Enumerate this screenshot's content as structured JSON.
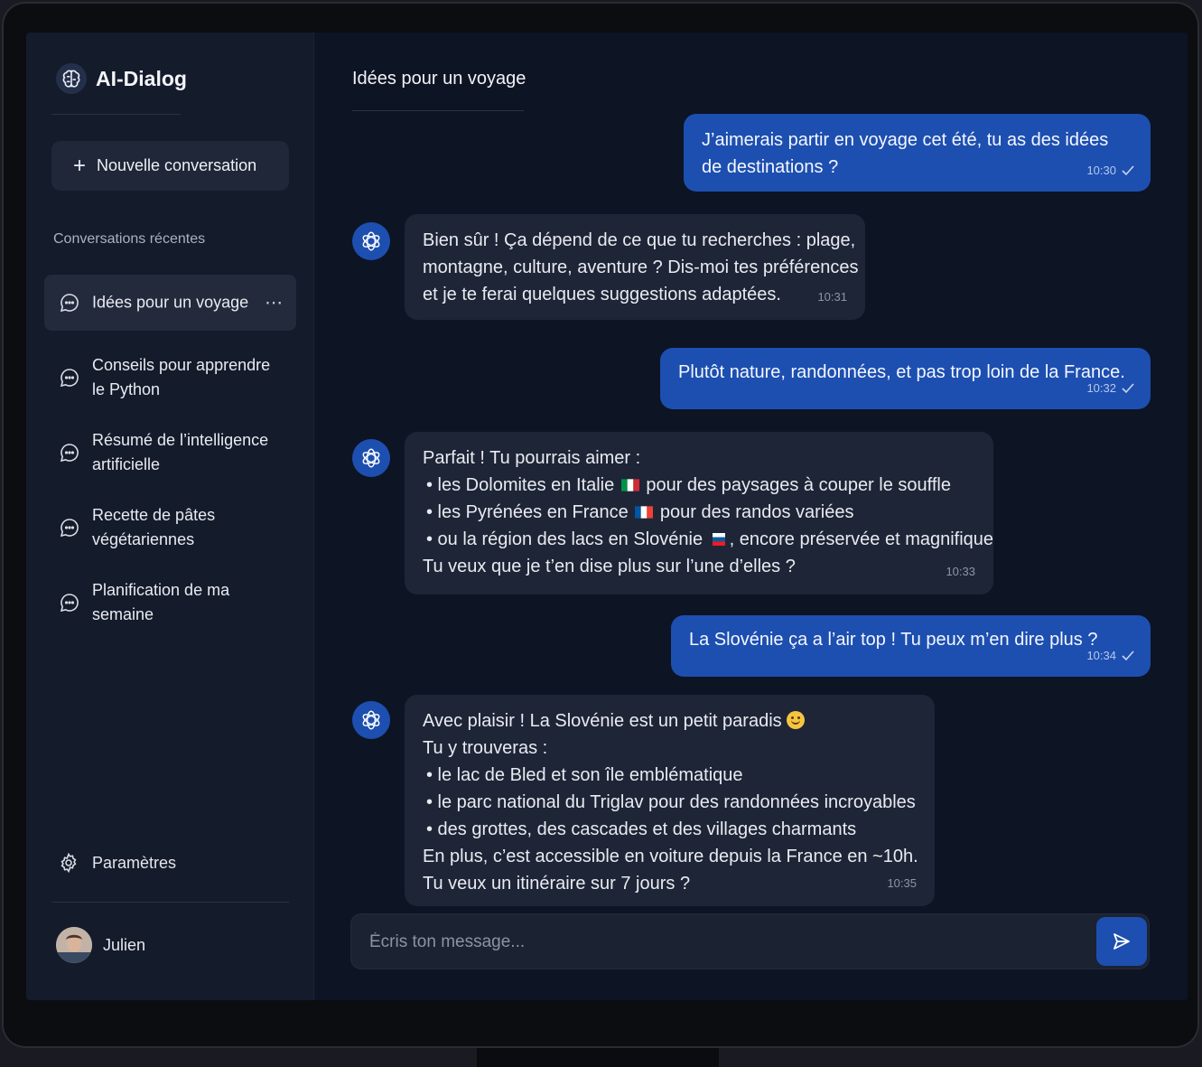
{
  "app": {
    "name": "AI-Dialog"
  },
  "sidebar": {
    "new_chat_label": "Nouvelle conversation",
    "recent_title": "Conversations récentes",
    "conversations": [
      {
        "label": "Idées pour un voyage",
        "active": true
      },
      {
        "label": "Conseils pour apprendre le Python"
      },
      {
        "label": "Résumé de l’intelligence artificielle"
      },
      {
        "label": "Recette de pâtes végétariennes"
      },
      {
        "label": "Planification de ma semaine"
      }
    ],
    "more_icon": "⋯",
    "settings_label": "Paramètres",
    "user_name": "Julien"
  },
  "chat": {
    "title": "Idées pour un voyage",
    "messages": [
      {
        "role": "user",
        "lines": [
          "J’aimerais partir en voyage cet été, tu as des idées",
          "de destinations ?"
        ],
        "time": "10:30"
      },
      {
        "role": "assistant",
        "lines": [
          "Bien sûr ! Ça dépend de ce que tu recherches : plage,",
          "montagne, culture, aventure ? Dis-moi tes préférences",
          "et je te ferai quelques suggestions adaptées."
        ],
        "time": "10:31"
      },
      {
        "role": "user",
        "lines": [
          "Plutôt nature, randonnées, et pas trop loin de la France."
        ],
        "time": "10:32"
      },
      {
        "role": "assistant",
        "lines": [
          "Parfait ! Tu pourrais aimer :",
          "• les Dolomites en Italie",
          "pour des paysages à couper le souffle",
          "• les Pyrénées en France",
          "pour des randos variées",
          "• ou la région des lacs en Slovénie",
          ", encore préservée et magnifique",
          "Tu veux que je t’en dise plus sur l’une d’elles ?"
        ],
        "time": "10:33"
      },
      {
        "role": "user",
        "lines": [
          "La Slovénie ça a l’air top ! Tu peux m’en dire plus ?"
        ],
        "time": "10:34"
      },
      {
        "role": "assistant",
        "lines": [
          "Avec plaisir ! La Slovénie est un petit paradis",
          "Tu y trouveras :",
          "• le lac de Bled et son île emblématique",
          "• le parc national du Triglav pour des randonnées incroyables",
          "• des grottes, des cascades et des villages charmants",
          "En plus, c’est accessible en voiture depuis la France en ~10h.",
          "Tu veux un itinéraire sur 7 jours ?"
        ],
        "time": "10:35"
      }
    ],
    "composer_placeholder": "Écris ton message..."
  },
  "colors": {
    "accent": "#1d4fb0",
    "background": "#0d1424",
    "sidebar": "#141b2b",
    "bubble_ai": "#1e2536"
  }
}
